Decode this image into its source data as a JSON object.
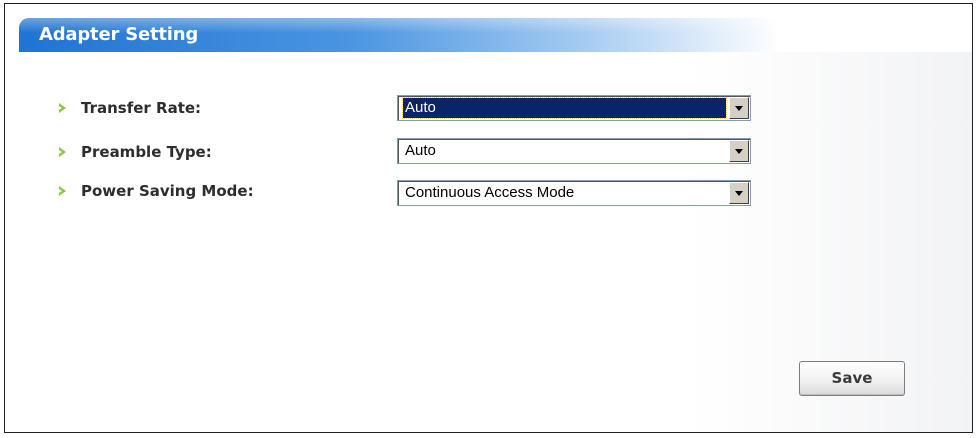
{
  "panel": {
    "title": "Adapter Setting"
  },
  "settings": [
    {
      "label": "Transfer Rate:",
      "value": "Auto",
      "focused": true
    },
    {
      "label": "Preamble Type:",
      "value": "Auto",
      "focused": false
    },
    {
      "label": "Power Saving Mode:",
      "value": "Continuous Access Mode",
      "focused": false
    }
  ],
  "actions": {
    "save_label": "Save"
  },
  "icons": {
    "bullet": "chevron-right-icon",
    "dropdown": "chevron-down-icon"
  },
  "colors": {
    "title_bar": "#2b78d4",
    "bullet": "#8dc63f",
    "selected_highlight": "#0a246a"
  }
}
